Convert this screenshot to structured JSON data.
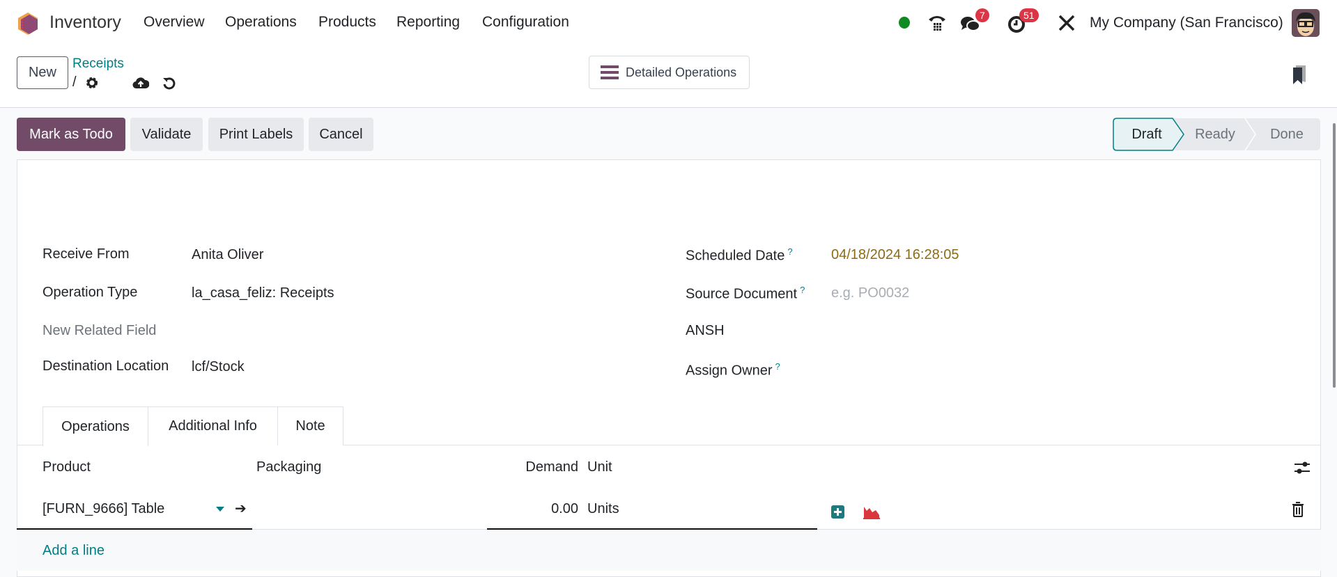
{
  "nav": {
    "app": "Inventory",
    "menu": [
      "Overview",
      "Operations",
      "Products",
      "Reporting",
      "Configuration"
    ],
    "messages_count": "7",
    "activities_count": "51",
    "company": "My Company (San Francisco)",
    "presence_color": "#0d8a22"
  },
  "control": {
    "new_label": "New",
    "breadcrumb": "Receipts",
    "breadcrumb_sep": "/",
    "detailed_ops_label": "Detailed Operations"
  },
  "actions": {
    "mark_todo": "Mark as Todo",
    "validate": "Validate",
    "print_labels": "Print Labels",
    "cancel": "Cancel"
  },
  "status": {
    "stages": [
      "Draft",
      "Ready",
      "Done"
    ],
    "current": "Draft"
  },
  "form": {
    "left": [
      {
        "label": "Receive From",
        "value": "Anita Oliver"
      },
      {
        "label": "Operation Type",
        "value": "la_casa_feliz: Receipts"
      },
      {
        "label": "New Related Field",
        "value": ""
      },
      {
        "label": "Destination Location",
        "value": "lcf/Stock"
      }
    ],
    "right": [
      {
        "label": "Scheduled Date",
        "value": "04/18/2024 16:28:05",
        "help": "?"
      },
      {
        "label": "Source Document",
        "placeholder": "e.g. PO0032",
        "help": "?"
      },
      {
        "label": "ANSH",
        "value": ""
      },
      {
        "label": "Assign Owner",
        "value": "",
        "help": "?"
      }
    ]
  },
  "tabs": [
    "Operations",
    "Additional Info",
    "Note"
  ],
  "table": {
    "headers": {
      "product": "Product",
      "packaging": "Packaging",
      "demand": "Demand",
      "unit": "Unit"
    },
    "rows": [
      {
        "product": "[FURN_9666] Table",
        "packaging": "",
        "demand": "0.00",
        "unit": "Units"
      }
    ],
    "add_line": "Add a line"
  },
  "colors": {
    "primary": "#714b67",
    "link": "#017e84",
    "date": "#8f6a14"
  }
}
